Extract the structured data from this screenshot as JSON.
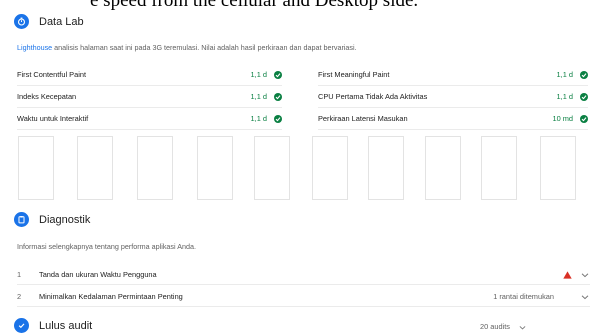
{
  "header_fragment": "e speed from the cellular and Desktop side.",
  "data_lab": {
    "title": "Data Lab",
    "desc_link": "Lighthouse",
    "desc_text": " analisis halaman saat ini pada 3G teremulasi. Nilai adalah hasil perkiraan dan dapat bervariasi."
  },
  "metrics_left": [
    {
      "label": "First Contentful Paint",
      "value": "1,1 d"
    },
    {
      "label": "Indeks Kecepatan",
      "value": "1,1 d"
    },
    {
      "label": "Waktu untuk Interaktif",
      "value": "1,1 d"
    }
  ],
  "metrics_right": [
    {
      "label": "First Meaningful Paint",
      "value": "1,1 d"
    },
    {
      "label": "CPU Pertama Tidak Ada Aktivitas",
      "value": "1,1 d"
    },
    {
      "label": "Perkiraan Latensi Masukan",
      "value": "10 md"
    }
  ],
  "diagnostics": {
    "title": "Diagnostik",
    "desc": "Informasi selengkapnya tentang performa aplikasi Anda.",
    "items": [
      {
        "num": "1",
        "title": "Tanda dan ukuran Waktu Pengguna",
        "detail": ""
      },
      {
        "num": "2",
        "title": "Minimalkan Kedalaman Permintaan Penting",
        "detail": "1 rantai ditemukan"
      }
    ]
  },
  "passed": {
    "title": "Lulus audit",
    "count": "20 audits"
  },
  "colors": {
    "accent": "#1a73e8",
    "pass": "#0b8043",
    "warn": "#d93025"
  }
}
